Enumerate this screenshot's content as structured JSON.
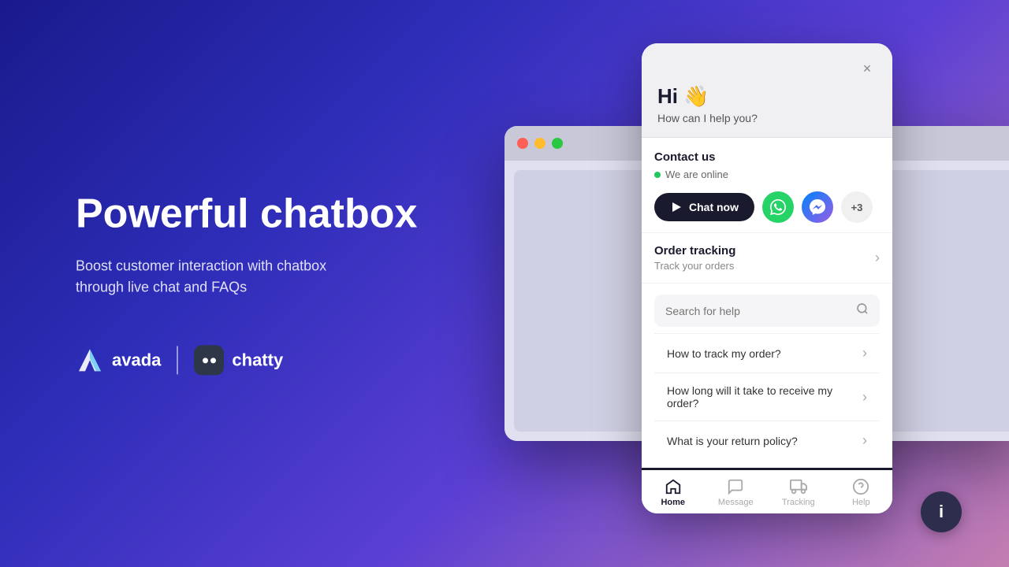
{
  "left": {
    "title": "Powerful chatbox",
    "subtitle": "Boost customer interaction with chatbox\nthrough live chat and FAQs",
    "brand_avada": "avada",
    "brand_chatty": "chatty"
  },
  "widget": {
    "close_label": "×",
    "greeting": "Hi 👋",
    "subgreeting": "How can I help you?",
    "contact": {
      "title": "Contact us",
      "online_status": "We are online",
      "chat_now_label": "Chat now",
      "social_buttons": [
        {
          "name": "whatsapp",
          "emoji": "💬"
        },
        {
          "name": "messenger",
          "emoji": "💬"
        }
      ],
      "more_label": "+3"
    },
    "order_tracking": {
      "title": "Order tracking",
      "subtitle": "Track your orders"
    },
    "search": {
      "placeholder": "Search for help"
    },
    "faqs": [
      {
        "text": "How to track my order?"
      },
      {
        "text": "How long will it take to receive my order?"
      },
      {
        "text": "What is your return policy?"
      }
    ],
    "nav": [
      {
        "label": "Home",
        "icon": "⌂",
        "active": true
      },
      {
        "label": "Message",
        "icon": "○",
        "active": false
      },
      {
        "label": "Tracking",
        "icon": "⊡",
        "active": false
      },
      {
        "label": "Help",
        "icon": "?",
        "active": false
      }
    ]
  },
  "info_button_label": "i"
}
